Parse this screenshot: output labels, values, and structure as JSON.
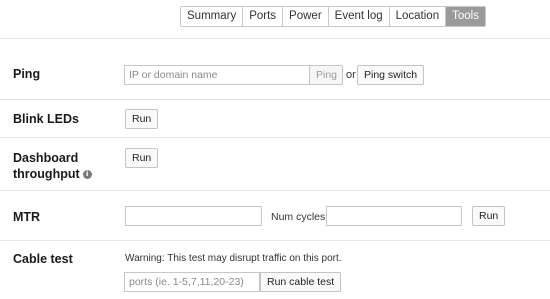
{
  "tabs": [
    {
      "label": "Summary",
      "active": false
    },
    {
      "label": "Ports",
      "active": false
    },
    {
      "label": "Power",
      "active": false
    },
    {
      "label": "Event log",
      "active": false
    },
    {
      "label": "Location",
      "active": false
    },
    {
      "label": "Tools",
      "active": true
    }
  ],
  "ping": {
    "label": "Ping",
    "input_placeholder": "IP or domain name",
    "input_value": "",
    "ping_button": "Ping",
    "or_text": "or",
    "ping_switch_button": "Ping switch"
  },
  "blink_leds": {
    "label": "Blink LEDs",
    "run_button": "Run"
  },
  "dashboard": {
    "label_line1": "Dashboard",
    "label_line2": "throughput",
    "info_icon": "info-icon",
    "run_button": "Run"
  },
  "mtr": {
    "label": "MTR",
    "host_value": "",
    "num_cycles_label": "Num cycles:",
    "num_cycles_value": "",
    "run_button": "Run"
  },
  "cable_test": {
    "label": "Cable test",
    "warning": "Warning: This test may disrupt traffic on this port.",
    "ports_placeholder": "ports (ie. 1-5,7,11,20-23)",
    "ports_value": "",
    "run_button": "Run cable test"
  }
}
